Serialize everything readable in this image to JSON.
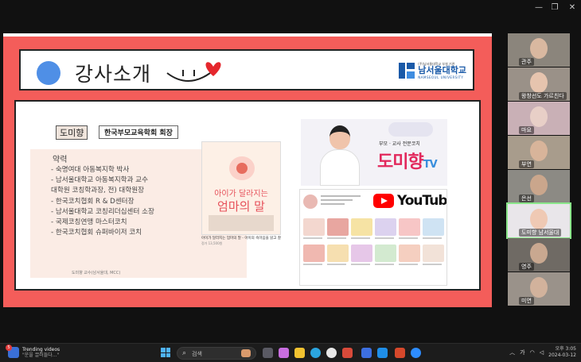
{
  "window": {
    "minimize_icon": "minimize-icon",
    "maximize_icon": "maximize-icon",
    "close_icon": "close-icon"
  },
  "slide": {
    "title": "강사소개",
    "university": {
      "subtitle": "(주)남서울대학교 부설 기관",
      "name": "남서울대학교",
      "english": "NAMSEOUL UNIVERSITY"
    },
    "instructor_name": "도미향",
    "instructor_title": "한국부모교육학회 회장",
    "career_heading": "약력",
    "career": [
      "- 숙명여대 아동복지학 박사",
      "- 남서울대학교 아동복지학과 교수",
      "   대학원 코칭학과장,  전) 대학원장",
      "- 한국코치협회 R & D센터장",
      "- 남서울대학교 코칭리더십센터 소장",
      "- 국제코칭연맹 마스터코치",
      "- 한국코치협회 슈퍼바이저 코치"
    ],
    "career_footer": "도미향 교수(남서울대, MCC)",
    "book": {
      "title_top": "아이가 달라지는",
      "title_main": "엄마의 말",
      "caption": "아이가 달라지는 엄마의 말 - 아이의 속마음을 읽고 잘",
      "caption2": "정가 13,500원"
    },
    "youtube": {
      "banner_subtitle": "부모 · 교사 전문코치",
      "brand": "도미향",
      "brand_suffix": "TV",
      "logo_text": "YouTube"
    }
  },
  "participants": [
    {
      "name": "관주",
      "face": "#d9b8a0",
      "bg": "#8b857c"
    },
    {
      "name": "왕창선도 가르친다",
      "face": "#e6c4ae",
      "bg": "#9a9188"
    },
    {
      "name": "마요",
      "face": "#e8cfc7",
      "bg": "#c9b0b6"
    },
    {
      "name": "부연",
      "face": "#d8b49a",
      "bg": "#a89c8c"
    },
    {
      "name": "은선",
      "face": "#caa68c",
      "bg": "#8c8a84"
    },
    {
      "name": "도미향 남서울대",
      "face": "#efc9b4",
      "bg": "#e9e6ea",
      "active": true
    },
    {
      "name": "영주",
      "face": "#c9a890",
      "bg": "#6f6a64"
    },
    {
      "name": "미연",
      "face": "#d2b29c",
      "bg": "#9a928a"
    }
  ],
  "taskbar": {
    "widget_badge": "5",
    "widget_title": "Trending videos",
    "widget_sub": "\"운을 끌러들다...\"",
    "search_placeholder": "검색",
    "ime_indicator": "가",
    "clock_time": "오후 3:05",
    "clock_date": "2024-03-12"
  }
}
